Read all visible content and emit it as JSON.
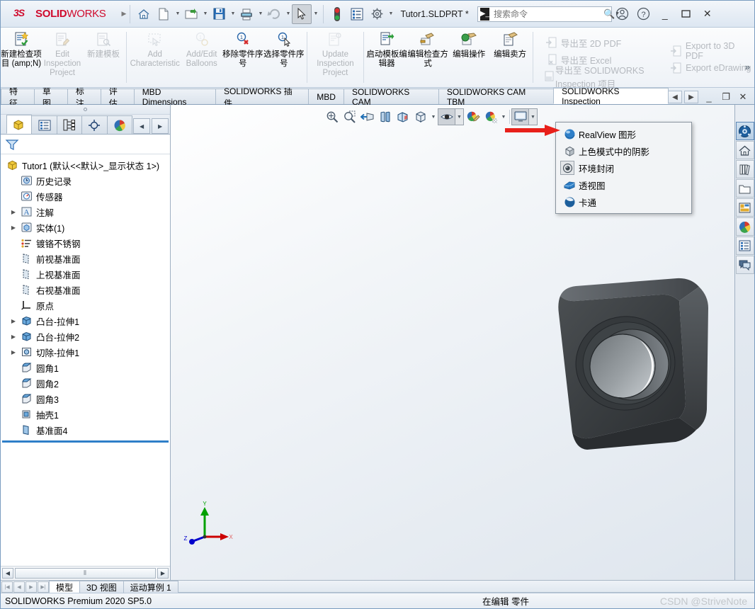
{
  "titlebar": {
    "brand_ds": "2S",
    "brand_solid": "SOLID",
    "brand_works": "WORKS",
    "doc_title": "Tutor1.SLDPRT *",
    "search_placeholder": "搜索命令",
    "buttons": {
      "home": "home-icon",
      "new": "new-doc-icon",
      "open": "open-folder-icon",
      "save": "save-icon",
      "print": "print-icon",
      "undo": "undo-icon",
      "select": "select-arrow-icon",
      "rebuild": "rebuild-icon",
      "options": "options-icon",
      "account": "account-icon",
      "help": "help-icon",
      "minimize": "minimize-icon",
      "maximize": "maximize-icon",
      "close": "close-icon"
    }
  },
  "ribbon": {
    "buttons": [
      {
        "label": "新建检查项目 (amp;N)",
        "icon": "new-inspection-icon",
        "disabled": false
      },
      {
        "label": "Edit Inspection Project",
        "icon": "edit-inspection-icon",
        "disabled": true
      },
      {
        "label": "新建模板",
        "icon": "new-template-icon",
        "disabled": true
      },
      {
        "label": "Add Characteristic",
        "icon": "add-characteristic-icon",
        "disabled": true
      },
      {
        "label": "Add/Edit Balloons",
        "icon": "balloon-icon",
        "disabled": true
      },
      {
        "label": "移除零件序号",
        "icon": "remove-balloon-icon",
        "disabled": false
      },
      {
        "label": "选择零件序号",
        "icon": "select-balloon-icon",
        "disabled": false
      },
      {
        "label": "Update Inspection Project",
        "icon": "update-inspection-icon",
        "disabled": true
      },
      {
        "label": "启动模板编辑器",
        "icon": "template-editor-icon",
        "disabled": false
      },
      {
        "label": "编辑检查方式",
        "icon": "edit-method-icon",
        "disabled": false
      },
      {
        "label": "编辑操作",
        "icon": "edit-operation-icon",
        "disabled": false
      },
      {
        "label": "编辑卖方",
        "icon": "edit-vendor-icon",
        "disabled": false
      }
    ],
    "exports_left": [
      {
        "label": "导出至 2D PDF",
        "icon": "export-pdf-icon"
      },
      {
        "label": "导出至 Excel",
        "icon": "export-excel-icon"
      },
      {
        "label": "导出至 SOLIDWORKS Inspection 项目",
        "icon": "export-swi-icon"
      }
    ],
    "exports_right": [
      {
        "label": "Export to 3D PDF",
        "icon": "export-3dpdf-icon"
      },
      {
        "label": "Export eDrawing",
        "icon": "export-edrawing-icon"
      }
    ],
    "more": "»"
  },
  "tabs": {
    "items": [
      {
        "label": "特征",
        "selected": false
      },
      {
        "label": "草图",
        "selected": false
      },
      {
        "label": "标注",
        "selected": false
      },
      {
        "label": "评估",
        "selected": false
      },
      {
        "label": "MBD Dimensions",
        "selected": false
      },
      {
        "label": "SOLIDWORKS 插件",
        "selected": false
      },
      {
        "label": "MBD",
        "selected": false
      },
      {
        "label": "SOLIDWORKS CAM",
        "selected": false
      },
      {
        "label": "SOLIDWORKS CAM TBM",
        "selected": false
      },
      {
        "label": "SOLIDWORKS Inspection",
        "selected": true
      }
    ],
    "controls": [
      "◀",
      "▶",
      "_",
      "❐",
      "✕"
    ]
  },
  "feature_manager": {
    "tabs": [
      {
        "name": "feature-tree-tab",
        "selected": true
      },
      {
        "name": "property-manager-tab",
        "selected": false
      },
      {
        "name": "configuration-manager-tab",
        "selected": false
      },
      {
        "name": "dimxpert-manager-tab",
        "selected": false
      },
      {
        "name": "display-manager-tab",
        "selected": false
      }
    ],
    "nav": [
      "◀",
      "▶"
    ],
    "filter_placeholder": "",
    "root": "Tutor1  (默认<<默认>_显示状态 1>)",
    "items": [
      {
        "label": "历史记录",
        "icon": "history-icon",
        "indent": 1,
        "expandable": false
      },
      {
        "label": "传感器",
        "icon": "sensors-icon",
        "indent": 1,
        "expandable": false
      },
      {
        "label": "注解",
        "icon": "annotations-icon",
        "indent": 1,
        "expandable": true
      },
      {
        "label": "实体(1)",
        "icon": "solid-bodies-icon",
        "indent": 1,
        "expandable": true
      },
      {
        "label": "镀铬不锈钢",
        "icon": "material-icon",
        "indent": 1,
        "expandable": false
      },
      {
        "label": "前视基准面",
        "icon": "plane-icon",
        "indent": 1,
        "expandable": false
      },
      {
        "label": "上视基准面",
        "icon": "plane-icon",
        "indent": 1,
        "expandable": false
      },
      {
        "label": "右视基准面",
        "icon": "plane-icon",
        "indent": 1,
        "expandable": false
      },
      {
        "label": "原点",
        "icon": "origin-icon",
        "indent": 1,
        "expandable": false
      },
      {
        "label": "凸台-拉伸1",
        "icon": "extrude-boss-icon",
        "indent": 1,
        "expandable": true
      },
      {
        "label": "凸台-拉伸2",
        "icon": "extrude-boss-icon",
        "indent": 1,
        "expandable": true
      },
      {
        "label": "切除-拉伸1",
        "icon": "extrude-cut-icon",
        "indent": 1,
        "expandable": true
      },
      {
        "label": "圆角1",
        "icon": "fillet-icon",
        "indent": 1,
        "expandable": false
      },
      {
        "label": "圆角2",
        "icon": "fillet-icon",
        "indent": 1,
        "expandable": false
      },
      {
        "label": "圆角3",
        "icon": "fillet-icon",
        "indent": 1,
        "expandable": false
      },
      {
        "label": "抽壳1",
        "icon": "shell-icon",
        "indent": 1,
        "expandable": false
      },
      {
        "label": "基准面4",
        "icon": "plane-icon",
        "indent": 1,
        "expandable": false
      }
    ],
    "hscroll_grip": "⦀"
  },
  "view_toolbar": {
    "buttons": [
      {
        "name": "zoom-to-fit-icon",
        "pressed": false,
        "caret": false
      },
      {
        "name": "zoom-to-area-icon",
        "pressed": false,
        "caret": false
      },
      {
        "name": "previous-view-icon",
        "pressed": false,
        "caret": false
      },
      {
        "name": "section-view-icon",
        "pressed": false,
        "caret": false
      },
      {
        "name": "view-orientation-icon",
        "pressed": false,
        "caret": false
      },
      {
        "name": "display-style-icon",
        "pressed": false,
        "caret": true
      },
      {
        "name": "hide-show-items-icon",
        "pressed": false,
        "caret": true
      },
      {
        "name": "view-settings-icon",
        "pressed": true,
        "caret": true
      },
      {
        "name": "apply-scene-icon",
        "pressed": false,
        "caret": false
      },
      {
        "name": "view-setting-scene-icon",
        "pressed": false,
        "caret": true
      },
      {
        "name": "viewport-icon",
        "pressed": true,
        "caret": true
      }
    ]
  },
  "view_settings_menu": {
    "items": [
      {
        "label": "RealView 图形",
        "icon": "realview-sphere-icon",
        "framed": false
      },
      {
        "label": "上色模式中的阴影",
        "icon": "shadows-cube-icon",
        "framed": false
      },
      {
        "label": "环境封闭",
        "icon": "ambient-occlusion-icon",
        "framed": true
      },
      {
        "label": "透视图",
        "icon": "perspective-icon",
        "framed": false
      },
      {
        "label": "卡通",
        "icon": "cartoon-sphere-icon",
        "framed": false
      }
    ],
    "annotation_arrow_color": "#e8201a"
  },
  "right_dock": {
    "items": [
      {
        "name": "solidworks-resources-icon",
        "active": true
      },
      {
        "name": "design-library-home-icon",
        "active": false
      },
      {
        "name": "file-explorer-icon",
        "active": false
      },
      {
        "name": "view-palette-icon",
        "active": false
      },
      {
        "name": "appearances-scenes-icon",
        "active": false
      },
      {
        "name": "display-states-sphere-icon",
        "active": false
      },
      {
        "name": "custom-properties-icon",
        "active": false
      },
      {
        "name": "swift-feedback-icon",
        "active": false
      }
    ]
  },
  "triad": {
    "x_label": "X",
    "y_label": "Y",
    "z_label": "Z"
  },
  "bottom": {
    "nav_buttons": [
      "|◀",
      "◀",
      "▶",
      "▶|"
    ],
    "tabs": [
      {
        "label": "模型",
        "selected": true
      },
      {
        "label": "3D 视图",
        "selected": false
      },
      {
        "label": "运动算例 1",
        "selected": false
      }
    ]
  },
  "statusbar": {
    "left": "SOLIDWORKS Premium 2020 SP5.0",
    "center": "在编辑 零件",
    "watermark": "CSDN @StriveNote"
  }
}
